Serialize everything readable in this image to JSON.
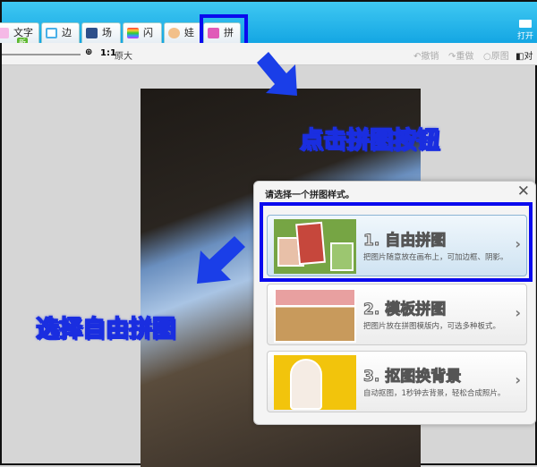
{
  "tabs": [
    {
      "label": "文字",
      "badge": "新",
      "icon": "text-icon"
    },
    {
      "label": "边框",
      "icon": "frame-icon"
    },
    {
      "label": "场景",
      "icon": "scene-icon"
    },
    {
      "label": "闪图",
      "icon": "flash-icon"
    },
    {
      "label": "娃娃",
      "icon": "doll-icon"
    },
    {
      "label": "拼图",
      "icon": "collage-icon"
    }
  ],
  "open_label": "打开",
  "toolbar": {
    "zoom_ratio": "1:1",
    "zoom_text": "原大",
    "undo": "撤销",
    "redo": "重做",
    "original": "原图",
    "compare": "对"
  },
  "annotations": {
    "click_collage": "点击拼图按钮",
    "choose_free": "选择自由拼图"
  },
  "dialog": {
    "title": "请选择一个拼图样式。",
    "options": [
      {
        "title": "1. 自由拼图",
        "desc": "把图片随意放在画布上，可加边框、阴影。"
      },
      {
        "title": "2. 模板拼图",
        "desc": "把图片放在拼图模版内，可选多种板式。"
      },
      {
        "title": "3. 抠图换背景",
        "desc": "自动抠图，1秒钟去背景，轻松合成照片。"
      }
    ]
  },
  "colors": {
    "accent": "#14a6e3",
    "highlight": "#0a0aee"
  }
}
